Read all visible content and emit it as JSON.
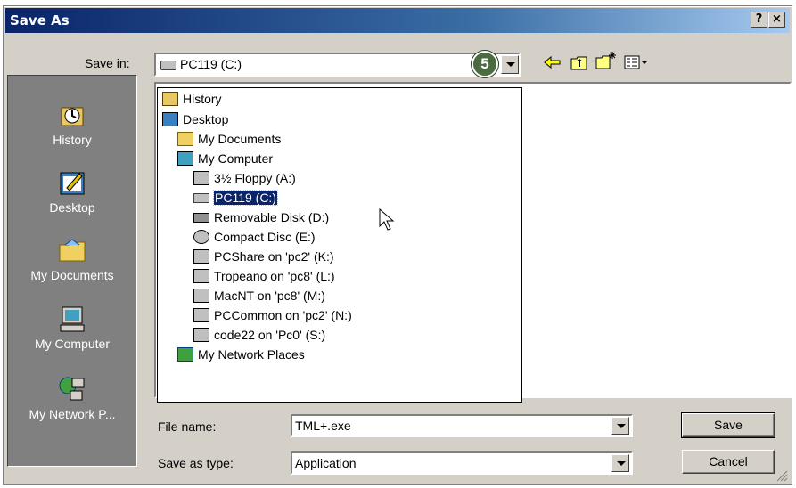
{
  "window": {
    "title": "Save As",
    "help_label": "?",
    "close_label": "×"
  },
  "save_in": {
    "label": "Save in:",
    "value": "PC119 (C:)"
  },
  "step_badge": "5",
  "places": [
    {
      "label": "History",
      "icon": "history-icon"
    },
    {
      "label": "Desktop",
      "icon": "desktop-icon"
    },
    {
      "label": "My Documents",
      "icon": "my-documents-icon"
    },
    {
      "label": "My Computer",
      "icon": "my-computer-icon"
    },
    {
      "label": "My Network P...",
      "icon": "network-places-icon"
    }
  ],
  "dropdown_items": [
    {
      "label": "History",
      "icon": "history-icon",
      "level": 0
    },
    {
      "label": "Desktop",
      "icon": "desktop-icon",
      "level": 0
    },
    {
      "label": "My Documents",
      "icon": "my-documents-icon",
      "level": 1
    },
    {
      "label": "My Computer",
      "icon": "my-computer-icon",
      "level": 1
    },
    {
      "label": "3½ Floppy (A:)",
      "icon": "floppy-drive-icon",
      "level": 2
    },
    {
      "label": "PC119 (C:)",
      "icon": "hard-drive-icon",
      "level": 2,
      "selected": true
    },
    {
      "label": "Removable Disk (D:)",
      "icon": "removable-disk-icon",
      "level": 2
    },
    {
      "label": "Compact Disc (E:)",
      "icon": "cd-drive-icon",
      "level": 2
    },
    {
      "label": "PCShare on 'pc2' (K:)",
      "icon": "network-drive-icon",
      "level": 2
    },
    {
      "label": "Tropeano on 'pc8' (L:)",
      "icon": "network-drive-icon",
      "level": 2
    },
    {
      "label": "MacNT on 'pc8' (M:)",
      "icon": "network-drive-icon",
      "level": 2
    },
    {
      "label": "PCCommon on 'pc2' (N:)",
      "icon": "network-drive-icon",
      "level": 2
    },
    {
      "label": "code22 on 'Pc0' (S:)",
      "icon": "network-drive-icon",
      "level": 2
    },
    {
      "label": "My Network Places",
      "icon": "network-places-icon",
      "level": 1
    }
  ],
  "file_name": {
    "label": "File name:",
    "value": "TML+.exe"
  },
  "save_as_type": {
    "label": "Save as type:",
    "value": "Application"
  },
  "buttons": {
    "save": "Save",
    "cancel": "Cancel"
  },
  "colors": {
    "title_start": "#0a246a",
    "title_end": "#a6caf0",
    "face": "#d4d0c8",
    "selection": "#0a246a",
    "badge": "#4a6a40"
  }
}
